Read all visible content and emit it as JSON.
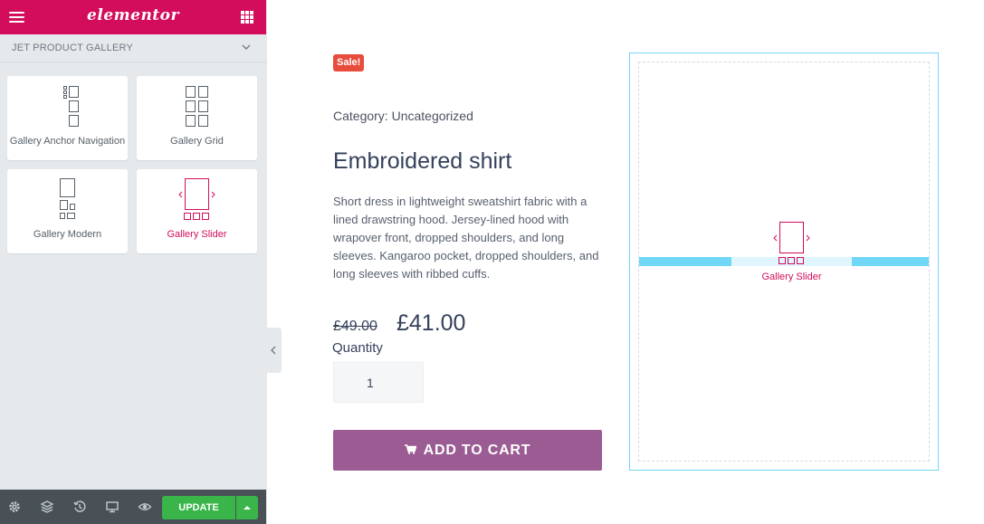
{
  "editor": {
    "brand": "elementor",
    "section_title": "JET PRODUCT GALLERY",
    "widgets": [
      {
        "label": "Gallery Anchor Navigation"
      },
      {
        "label": "Gallery Grid"
      },
      {
        "label": "Gallery Modern"
      },
      {
        "label": "Gallery Slider"
      }
    ],
    "update_label": "UPDATE"
  },
  "product": {
    "badge": "Sale!",
    "category": "Category: Uncategorized",
    "title": "Embroidered shirt",
    "description": "Short dress in lightweight sweatshirt fabric with a lined drawstring hood. Jersey-lined hood with wrapover front, dropped shoulders, and long sleeves. Kangaroo pocket, dropped shoulders, and long sleeves with ribbed cuffs.",
    "price_old": "£49.00",
    "price_new": "£41.00",
    "quantity_label": "Quantity",
    "quantity_value": "1",
    "add_to_cart": "ADD TO CART"
  },
  "dropzone": {
    "label": "Gallery Slider"
  },
  "colors": {
    "brand": "#d30c5c",
    "update": "#39b54a",
    "cart_button": "#9b5b93",
    "sale": "#e74c3c",
    "drop_highlight": "#71d7f7"
  }
}
